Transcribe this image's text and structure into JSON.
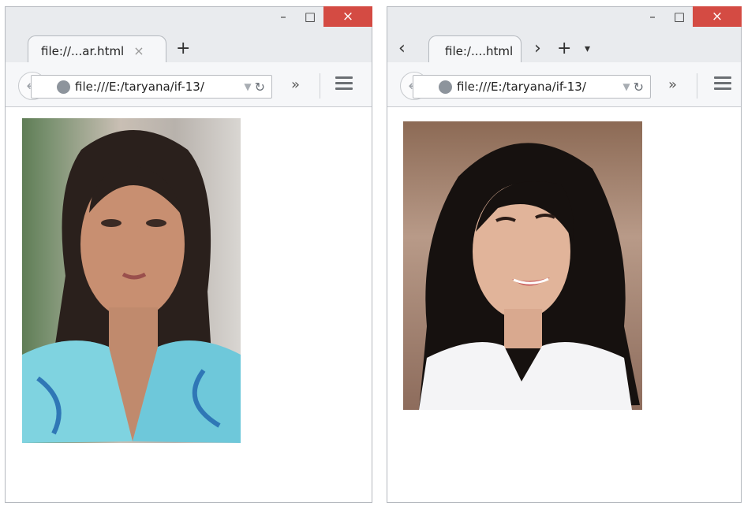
{
  "left_window": {
    "tab_title": "file://...ar.html",
    "tab_close": "×",
    "new_tab": "+",
    "url": "file:///E:/taryana/if-13/",
    "overflow": "»",
    "captions": {
      "minimize": "–",
      "maximize": "□",
      "close": "×"
    }
  },
  "right_window": {
    "tab_title": "file:/....html",
    "scroll_left": "‹",
    "scroll_right": "›",
    "new_tab": "+",
    "tab_list": "▾",
    "url": "file:///E:/taryana/if-13/",
    "overflow": "»",
    "captions": {
      "minimize": "–",
      "maximize": "□",
      "close": "×"
    }
  }
}
